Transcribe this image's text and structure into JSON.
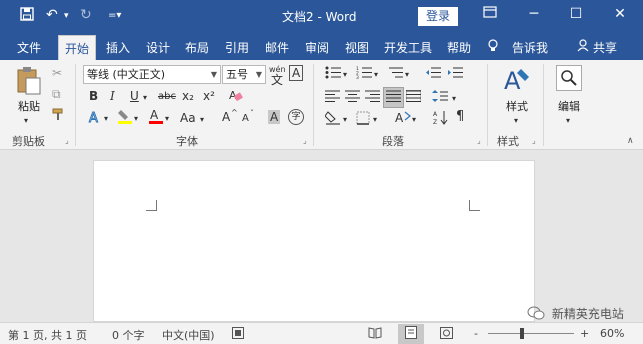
{
  "window": {
    "title": "文档2 - Word",
    "login_label": "登录",
    "save_icon": "save-icon",
    "undo_icon": "undo-icon",
    "redo_icon": "redo-icon",
    "customize_icon": "customize-quick-access-icon",
    "ribbon_display_icon": "ribbon-display-options-icon",
    "minimize_icon": "minimize-icon",
    "maximize_icon": "maximize-icon",
    "close_icon": "close-icon"
  },
  "tabs": [
    {
      "label": "文件"
    },
    {
      "label": "开始",
      "active": true
    },
    {
      "label": "插入"
    },
    {
      "label": "设计"
    },
    {
      "label": "布局"
    },
    {
      "label": "引用"
    },
    {
      "label": "邮件"
    },
    {
      "label": "审阅"
    },
    {
      "label": "视图"
    },
    {
      "label": "开发工具"
    },
    {
      "label": "帮助"
    }
  ],
  "tellme": {
    "label": "告诉我",
    "icon": "lightbulb-icon"
  },
  "share": {
    "label": "共享",
    "icon": "person-icon"
  },
  "ribbon": {
    "clipboard": {
      "group_label": "剪贴板",
      "paste_label": "粘贴",
      "paste_icon": "paste-icon",
      "cut_icon": "cut-icon",
      "copy_icon": "copy-icon",
      "format_painter_icon": "format-painter-icon"
    },
    "font": {
      "group_label": "字体",
      "font_name": "等线 (中文正文)",
      "font_size": "五号",
      "pinyin_label": "wén",
      "pinyin_char": "文",
      "bold": "B",
      "italic": "I",
      "underline": "U",
      "strikethrough": "abc",
      "subscript": "x₂",
      "superscript": "x²",
      "aa_case": "Aa",
      "grow_font": "A",
      "shrink_font": "A",
      "shading_char": "A",
      "enclose_char": "字",
      "highlight_icon": "highlighter-icon",
      "font_color_icon": "font-color-icon",
      "text_effects_icon": "text-effects-icon",
      "clear_format_icon": "clear-format-icon",
      "border_char": "A",
      "colors": {
        "highlight": "#ffff00",
        "font_color": "#ff0000"
      }
    },
    "paragraph": {
      "group_label": "段落",
      "bullets_icon": "bullets-icon",
      "numbering_icon": "numbering-icon",
      "multilevel_icon": "multilevel-list-icon",
      "decrease_indent_icon": "decrease-indent-icon",
      "increase_indent_icon": "increase-indent-icon",
      "align_left_icon": "align-left-icon",
      "center_icon": "align-center-icon",
      "align_right_icon": "align-right-icon",
      "justify_icon": "justify-icon",
      "distributed_icon": "distributed-icon",
      "line_spacing_icon": "line-spacing-icon",
      "shading_icon": "shading-icon",
      "borders_icon": "borders-icon",
      "chinese_layout_icon": "chinese-layout-icon",
      "sort_icon": "sort-icon",
      "show_marks_icon": "pilcrow-icon"
    },
    "styles": {
      "group_label": "样式",
      "button_label": "样式",
      "icon": "styles-icon"
    },
    "editing": {
      "button_label": "编辑",
      "icon": "search-icon"
    }
  },
  "status": {
    "page": "第 1 页, 共 1 页",
    "words": "0 个字",
    "language": "中文(中国)",
    "macro_icon": "macro-record-icon",
    "read_mode_icon": "read-mode-icon",
    "print_layout_icon": "print-layout-icon",
    "web_layout_icon": "web-layout-icon",
    "zoom_out": "-",
    "zoom_in": "+",
    "zoom": "60%",
    "zoom_value": 60
  },
  "watermark": {
    "text": "新精英充电站",
    "icon": "wechat-icon"
  }
}
